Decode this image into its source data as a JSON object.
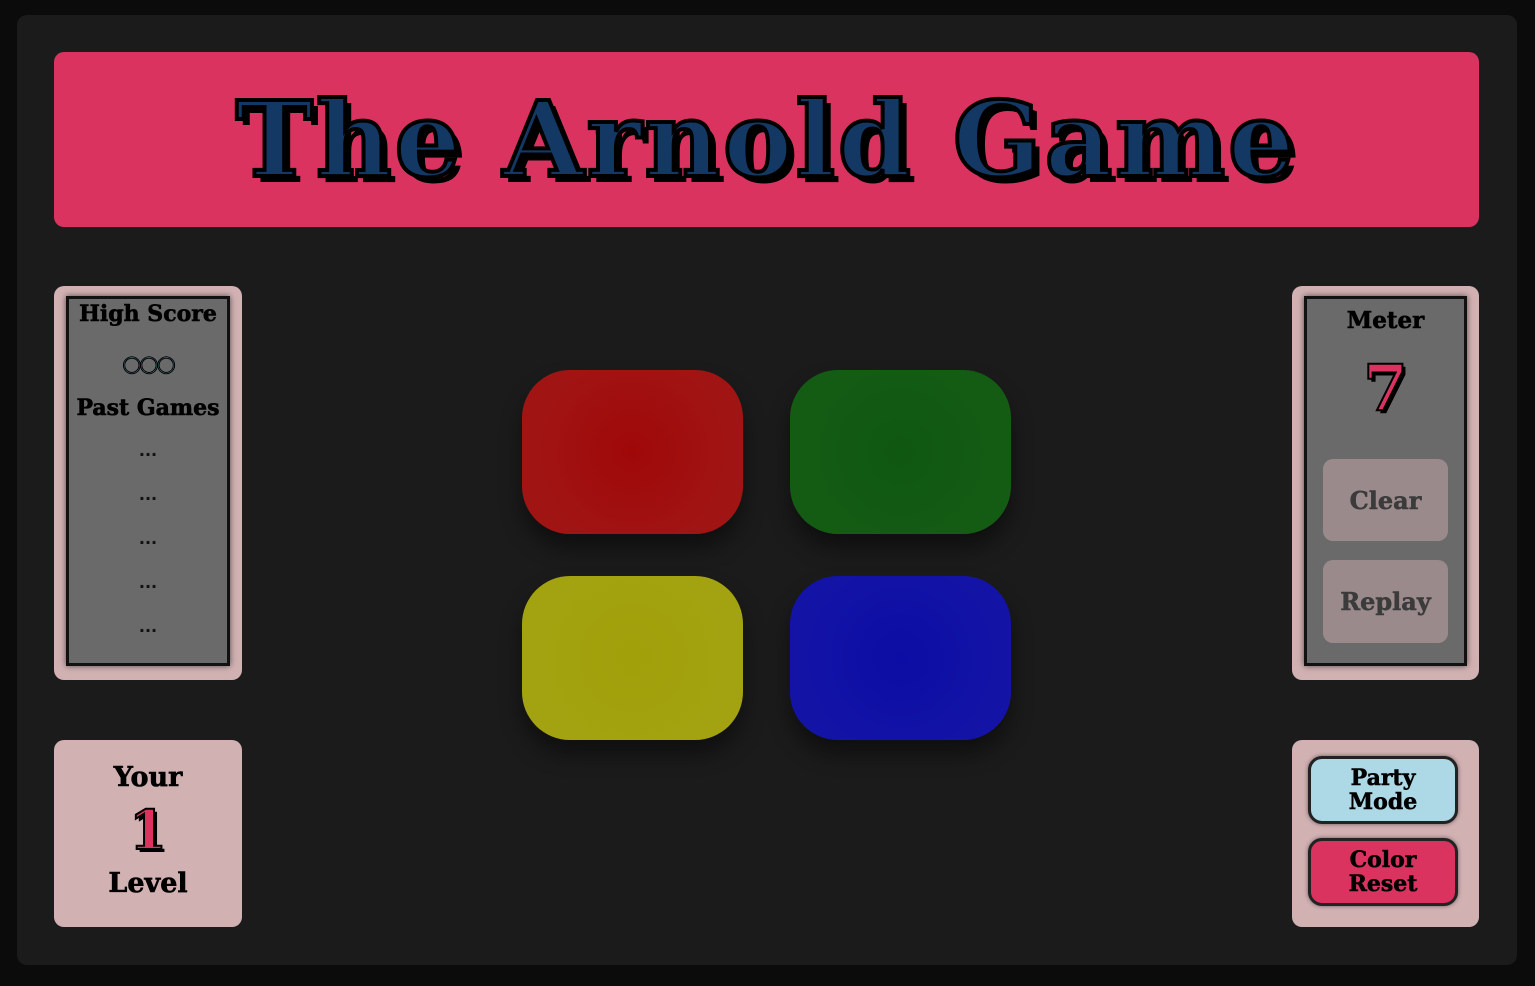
{
  "title": "The Arnold Game",
  "high_score": {
    "label": "High Score",
    "value": "○○○",
    "past_games_label": "Past Games",
    "past_games": [
      "...",
      "...",
      "...",
      "...",
      "..."
    ]
  },
  "meter": {
    "label": "Meter",
    "value": "7",
    "clear_label": "Clear",
    "replay_label": "Replay"
  },
  "level": {
    "top_label": "Your",
    "value": "1",
    "bottom_label": "Level"
  },
  "modes": {
    "party_label": "Party Mode",
    "reset_label": "Color Reset"
  },
  "pads": [
    {
      "color": "red",
      "hex": "#a00808"
    },
    {
      "color": "green",
      "hex": "#0f5812"
    },
    {
      "color": "yellow",
      "hex": "#a1a00a"
    },
    {
      "color": "blue",
      "hex": "#0b0da4"
    }
  ],
  "colors": {
    "accent_pink": "#db3360",
    "title_navy": "#133863",
    "panel_pink": "#d2b1b3",
    "party_blue": "#add8e6"
  }
}
